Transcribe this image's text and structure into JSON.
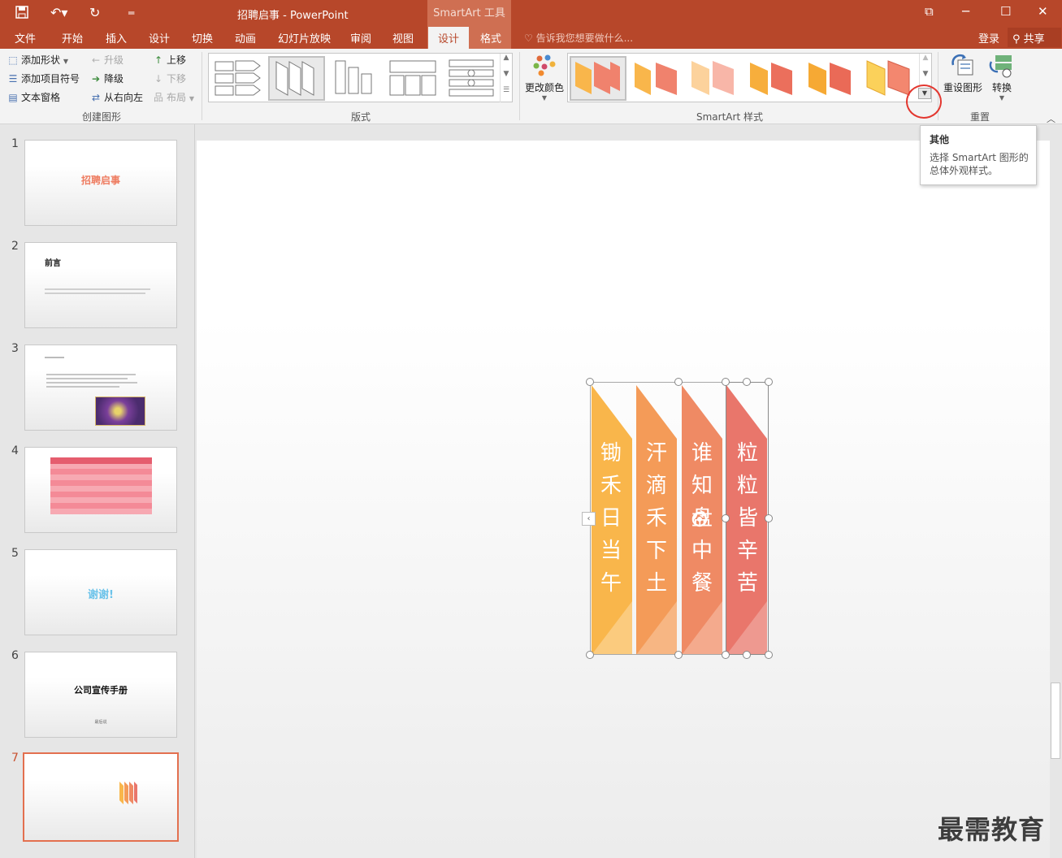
{
  "window": {
    "title": "招聘启事 - PowerPoint",
    "context_group": "SmartArt 工具",
    "buttons": [
      "⧉",
      "─",
      "☐",
      "✕"
    ]
  },
  "quick_access": [
    "save-icon",
    "undo-icon",
    "redo-icon",
    "customize-icon"
  ],
  "tabs": [
    {
      "label": "文件"
    },
    {
      "label": "开始"
    },
    {
      "label": "插入"
    },
    {
      "label": "设计"
    },
    {
      "label": "切换"
    },
    {
      "label": "动画"
    },
    {
      "label": "幻灯片放映"
    },
    {
      "label": "审阅"
    },
    {
      "label": "视图"
    },
    {
      "label": "设计"
    },
    {
      "label": "格式"
    }
  ],
  "tellme": "告诉我您想要做什么...",
  "account": {
    "login": "登录",
    "share": "共享"
  },
  "ribbon": {
    "create_graphic": {
      "label": "创建图形",
      "add_shape": "添加形状",
      "add_bullet": "添加项目符号",
      "text_pane": "文本窗格",
      "promote": "升级",
      "demote": "降级",
      "rtl": "从右向左",
      "move_up": "上移",
      "move_down": "下移",
      "layout": "布局"
    },
    "layouts": {
      "label": "版式"
    },
    "styles": {
      "label": "SmartArt 样式",
      "change_colors": "更改颜色"
    },
    "reset": {
      "label": "重置",
      "reset_graphic": "重设图形",
      "convert": "转换"
    }
  },
  "tooltip": {
    "title": "其他",
    "body": "选择 SmartArt 图形的总体外观样式。"
  },
  "slides": [
    {
      "num": "1",
      "title": "招聘启事"
    },
    {
      "num": "2",
      "title": "前言"
    },
    {
      "num": "3",
      "title": ""
    },
    {
      "num": "4",
      "title": ""
    },
    {
      "num": "5",
      "title": "谢谢!"
    },
    {
      "num": "6",
      "title": "公司宣传手册",
      "subtitle": "最后说"
    },
    {
      "num": "7",
      "title": ""
    }
  ],
  "smartart": {
    "columns": [
      {
        "text": "锄禾日当午",
        "color": "#f9b64b"
      },
      {
        "text": "汗滴禾下土",
        "color": "#f49b58"
      },
      {
        "text": "谁知盘中餐",
        "color": "#ef8a64"
      },
      {
        "text": "粒粒皆辛苦",
        "color": "#e9766b"
      }
    ]
  },
  "watermark": "最需教育",
  "colors": {
    "accent": "#b7472a",
    "context": "#cf6f52"
  }
}
